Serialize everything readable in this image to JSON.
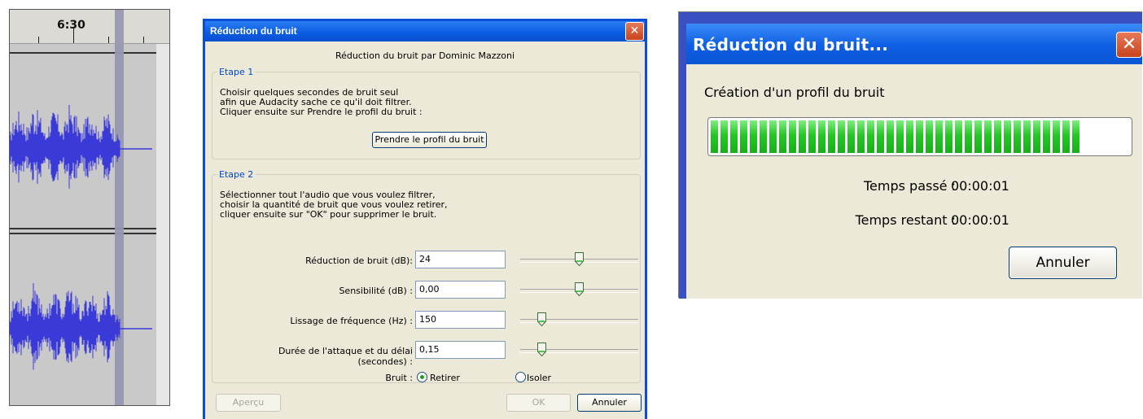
{
  "waveform": {
    "ruler_label": "6:30"
  },
  "noise_dialog": {
    "title": "Réduction du bruit",
    "close_glyph": "✕",
    "credit": "Réduction du bruit par Dominic Mazzoni",
    "step1": {
      "legend": "Etape 1",
      "lines": [
        "Choisir quelques secondes de bruit seul",
        "afin que Audacity sache ce qu'il doit filtrer.",
        "Cliquer ensuite sur Prendre le profil du bruit :"
      ],
      "button": "Prendre le profil du bruit"
    },
    "step2": {
      "legend": "Etape 2",
      "lines": [
        "Sélectionner tout l'audio que vous voulez filtrer,",
        "choisir la quantité de bruit que vous voulez retirer,",
        "cliquer ensuite sur \"OK\" pour supprimer le bruit."
      ],
      "params": [
        {
          "label": "Réduction de bruit (dB):",
          "value": "24",
          "slider_fraction": 0.5
        },
        {
          "label": "Sensibilité (dB) :",
          "value": "0,00",
          "slider_fraction": 0.5
        },
        {
          "label": "Lissage de fréquence (Hz) :",
          "value": "150",
          "slider_fraction": 0.16
        },
        {
          "label": "Durée de l'attaque et du délai (secondes) :",
          "value": "0,15",
          "slider_fraction": 0.16
        }
      ],
      "noise_label": "Bruit :",
      "option_remove": "Retirer",
      "option_isolate": "Isoler",
      "selected_option": "Retirer"
    },
    "buttons": {
      "preview": "Aperçu",
      "ok": "OK",
      "cancel": "Annuler"
    }
  },
  "progress_dialog": {
    "title": "Réduction du bruit...",
    "close_glyph": "✕",
    "status": "Création d'un profil du bruit",
    "progress_fraction": 0.9,
    "elapsed_label": "Temps passé :",
    "elapsed_value": "00:00:01",
    "remaining_label": "Temps restant :",
    "remaining_value": "00:00:01",
    "cancel_label": "Annuler"
  },
  "colors": {
    "title_blue": "#0b5be0",
    "waveform_blue": "#3a3ad8",
    "progress_green": "#26c526",
    "close_red": "#c8431d"
  }
}
